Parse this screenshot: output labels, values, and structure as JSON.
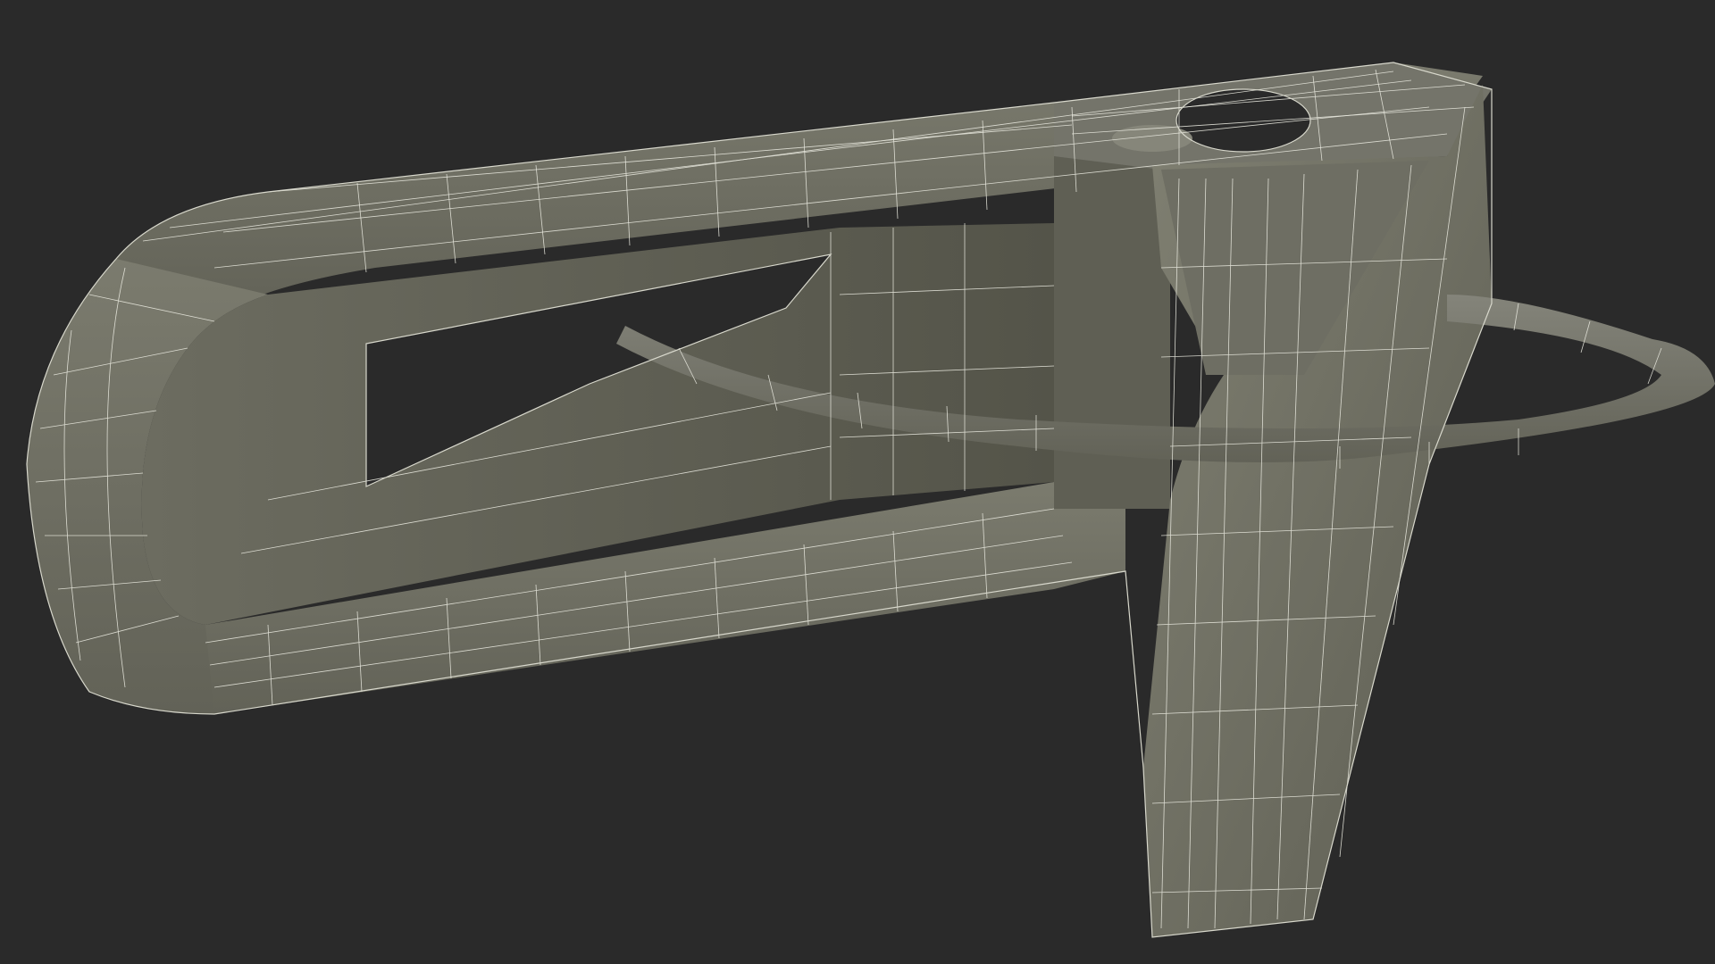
{
  "scene": {
    "background_color": "#2a2a2a",
    "model_fill_light": "#7a7a6c",
    "model_fill_mid": "#6a6a5d",
    "model_fill_dark": "#55554a",
    "wire_color": "#e8e8de",
    "hole_color": "#2a2a2a"
  }
}
